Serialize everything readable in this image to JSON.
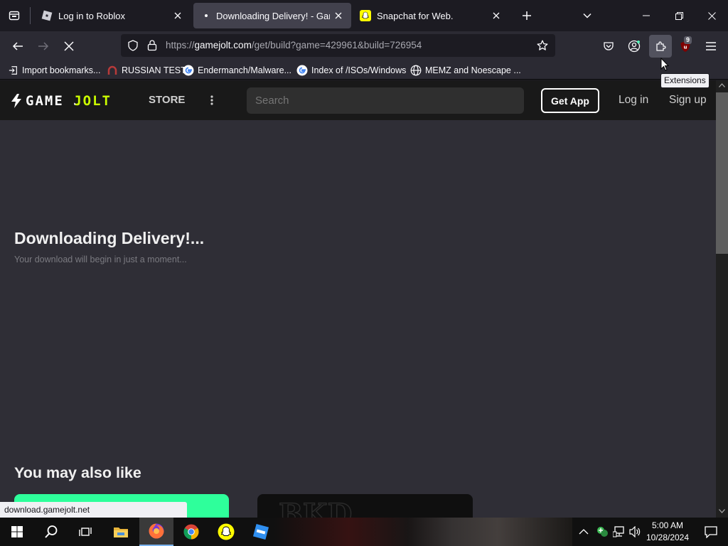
{
  "tabs": [
    {
      "title": "Log in to Roblox",
      "active": false
    },
    {
      "title": "Downloading Delivery! - Game",
      "active": true
    },
    {
      "title": "Snapchat for Web.",
      "active": false
    }
  ],
  "toolbar": {
    "url_prefix": "https://",
    "url_host": "gamejolt.com",
    "url_path": "/get/build?game=429961&build=726954",
    "extensions_badge": "9"
  },
  "tooltip": {
    "extensions": "Extensions"
  },
  "bookmarks": [
    {
      "label": "Import bookmarks...",
      "icon": "import-icon"
    },
    {
      "label": "RUSSIAN TEST",
      "icon": "red-arch-icon"
    },
    {
      "label": "Endermanch/Malware...",
      "icon": "google-icon"
    },
    {
      "label": "Index of /ISOs/Windows",
      "icon": "google-icon"
    },
    {
      "label": "MEMZ and Noescape ...",
      "icon": "globe-icon"
    }
  ],
  "gamejolt": {
    "logo_text": "GAME JOLT",
    "store": "STORE",
    "search_placeholder": "Search",
    "get_app": "Get App",
    "login": "Log in",
    "signup": "Sign up"
  },
  "main": {
    "title": "Downloading Delivery!...",
    "subtitle": "Your download will begin in just a moment...",
    "also_like": "You may also like"
  },
  "status_bar": "download.gamejolt.net",
  "taskbar": {
    "time": "5:00 AM",
    "date": "10/28/2024"
  },
  "colors": {
    "accent_green": "#2eff9b",
    "gamejolt_green": "#ccff00",
    "background": "#2f2e36"
  }
}
